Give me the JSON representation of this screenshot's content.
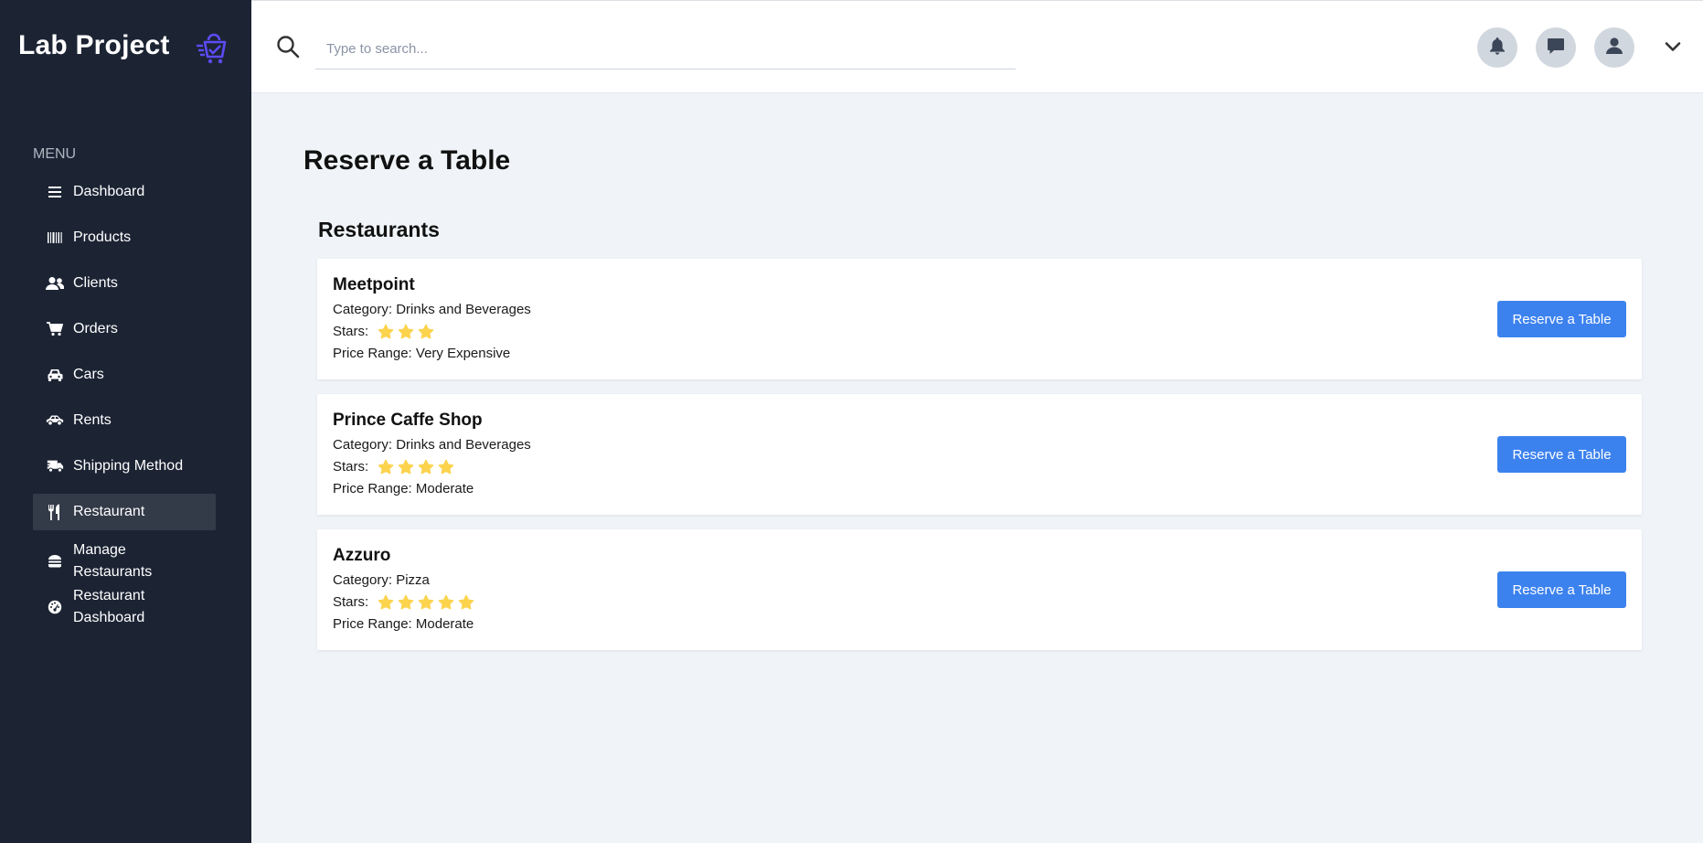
{
  "app": {
    "title": "Lab Project",
    "logo_icon": "shopping-basket-check-icon"
  },
  "sidebar": {
    "menu_heading": "MENU",
    "items": [
      {
        "label": "Dashboard",
        "icon": "menu-lines-icon"
      },
      {
        "label": "Products",
        "icon": "barcode-icon"
      },
      {
        "label": "Clients",
        "icon": "users-icon"
      },
      {
        "label": "Orders",
        "icon": "cart-icon"
      },
      {
        "label": "Cars",
        "icon": "car-icon"
      },
      {
        "label": "Rents",
        "icon": "car-side-icon"
      },
      {
        "label": "Shipping Method",
        "icon": "truck-icon"
      },
      {
        "label": "Restaurant",
        "icon": "utensils-icon",
        "active": true
      },
      {
        "label": "Manage\nRestaurants",
        "icon": "burger-icon"
      },
      {
        "label": "Restaurant\nDashboard",
        "icon": "gauge-icon"
      }
    ]
  },
  "topbar": {
    "search_placeholder": "Type to search...",
    "search_value": "",
    "icons": [
      "search-icon",
      "bell-icon",
      "chat-icon",
      "user-icon",
      "chevron-down-icon"
    ]
  },
  "page": {
    "title": "Reserve a Table",
    "section_title": "Restaurants"
  },
  "restaurants": [
    {
      "name": "Meetpoint",
      "category_label": "Category:",
      "category": "Drinks and Beverages",
      "stars_label": "Stars:",
      "stars": 3,
      "price_label": "Price Range:",
      "price_range": "Very Expensive",
      "button": "Reserve a Table"
    },
    {
      "name": "Prince Caffe Shop",
      "category_label": "Category:",
      "category": "Drinks and Beverages",
      "stars_label": "Stars:",
      "stars": 4,
      "price_label": "Price Range:",
      "price_range": "Moderate",
      "button": "Reserve a Table"
    },
    {
      "name": "Azzuro",
      "category_label": "Category:",
      "category": "Pizza",
      "stars_label": "Stars:",
      "stars": 5,
      "price_label": "Price Range:",
      "price_range": "Moderate",
      "button": "Reserve a Table"
    }
  ],
  "colors": {
    "sidebar_bg": "#1c2434",
    "accent_button": "#3c82ee",
    "star": "#fcd34d",
    "logo": "#5b4cf5"
  }
}
